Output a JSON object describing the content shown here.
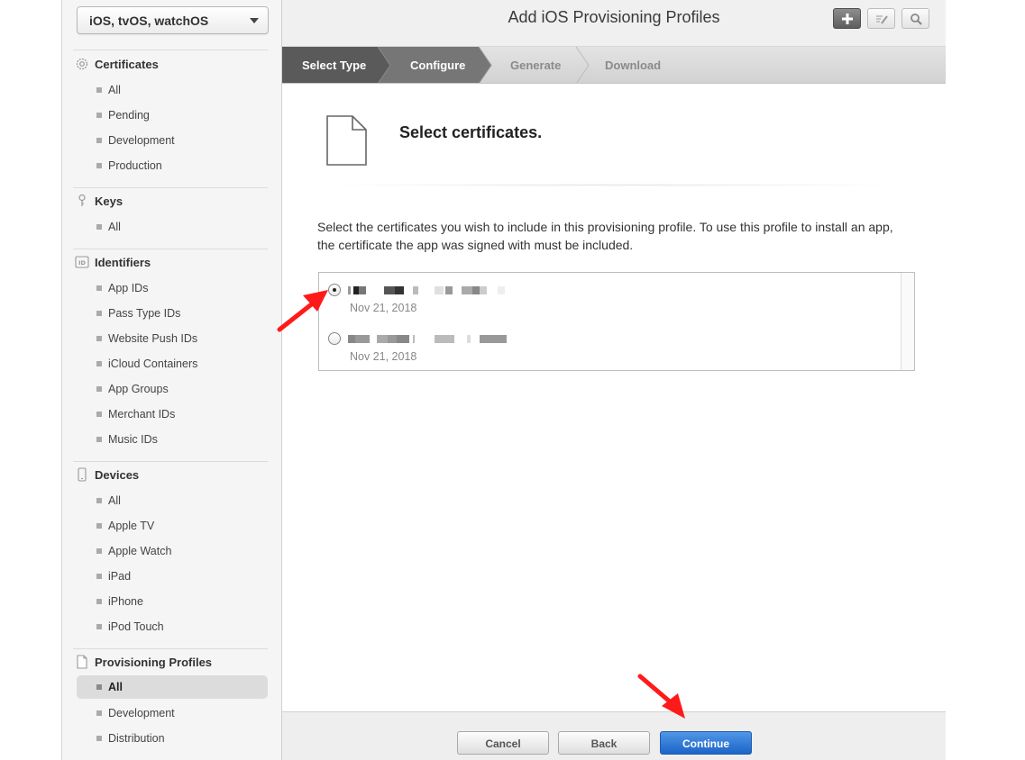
{
  "sidebar": {
    "platform": "iOS, tvOS, watchOS",
    "sections": [
      {
        "title": "Certificates",
        "icon": "gear-icon",
        "items": [
          "All",
          "Pending",
          "Development",
          "Production"
        ]
      },
      {
        "title": "Keys",
        "icon": "key-icon",
        "items": [
          "All"
        ]
      },
      {
        "title": "Identifiers",
        "icon": "id-icon",
        "items": [
          "App IDs",
          "Pass Type IDs",
          "Website Push IDs",
          "iCloud Containers",
          "App Groups",
          "Merchant IDs",
          "Music IDs"
        ]
      },
      {
        "title": "Devices",
        "icon": "device-icon",
        "items": [
          "All",
          "Apple TV",
          "Apple Watch",
          "iPad",
          "iPhone",
          "iPod Touch"
        ]
      },
      {
        "title": "Provisioning Profiles",
        "icon": "document-icon",
        "items": [
          "All",
          "Development",
          "Distribution"
        ],
        "active_item": "All"
      }
    ]
  },
  "header": {
    "title": "Add iOS Provisioning Profiles",
    "icons": [
      "plus-icon",
      "edit-icon",
      "search-icon"
    ]
  },
  "steps": [
    {
      "label": "Select Type",
      "state": "done"
    },
    {
      "label": "Configure",
      "state": "current"
    },
    {
      "label": "Generate",
      "state": "upcoming"
    },
    {
      "label": "Download",
      "state": "upcoming"
    }
  ],
  "content": {
    "section_title": "Select certificates.",
    "instructions": "Select the certificates you wish to include in this provisioning profile. To use this profile to install an app, the certificate the app was signed with must be included.",
    "certificates": [
      {
        "date": "Nov 21, 2018",
        "selected": true
      },
      {
        "date": "Nov 21, 2018",
        "selected": false
      }
    ]
  },
  "footer": {
    "cancel_label": "Cancel",
    "back_label": "Back",
    "continue_label": "Continue"
  },
  "colors": {
    "step_done": "#5a5a5a",
    "step_current": "#757575",
    "primary_button": "#1d64c9",
    "annotation_arrow": "#ff1a1a"
  }
}
